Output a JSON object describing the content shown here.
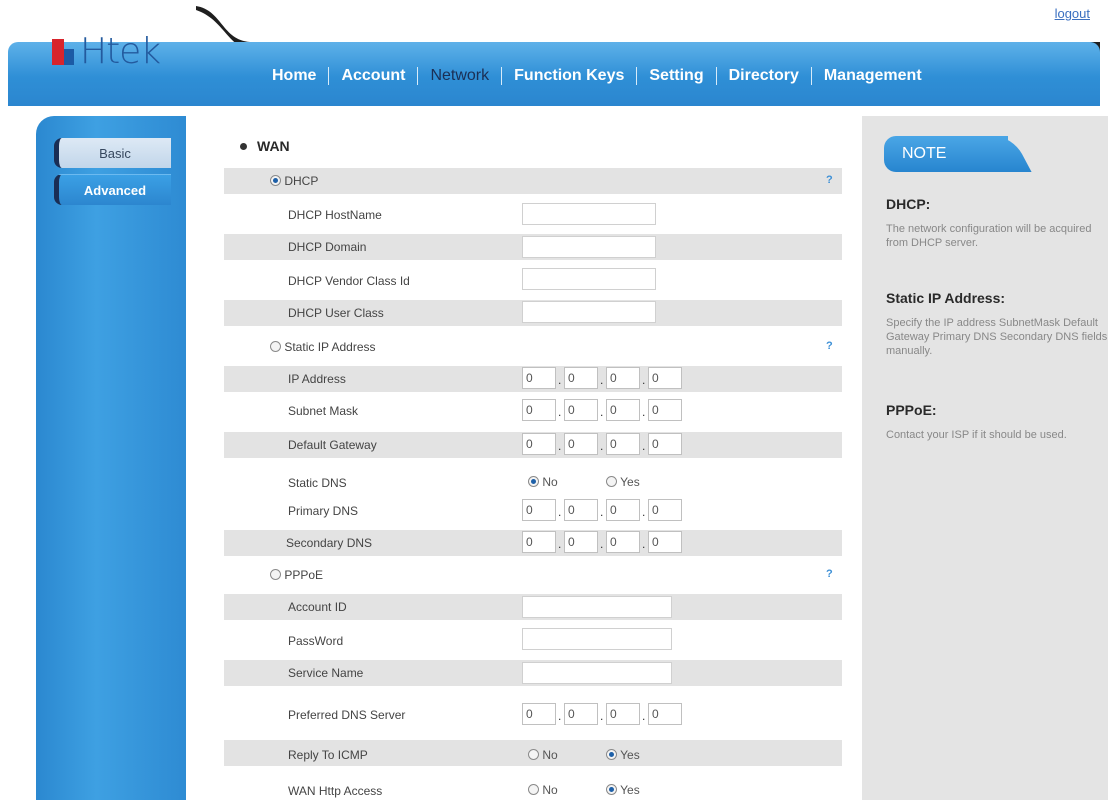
{
  "header": {
    "logo_text": "Htek",
    "logout": "logout",
    "nav": [
      "Home",
      "Account",
      "Network",
      "Function Keys",
      "Setting",
      "Directory",
      "Management"
    ],
    "active_nav": "Network"
  },
  "sidebar": {
    "tabs": [
      "Basic",
      "Advanced"
    ],
    "active": "Basic"
  },
  "form": {
    "section_title": "WAN",
    "help": "?",
    "dhcp": {
      "label": "DHCP",
      "selected": true,
      "fields": [
        "DHCP HostName",
        "DHCP Domain",
        "DHCP Vendor Class Id",
        "DHCP User Class"
      ]
    },
    "static": {
      "label": "Static IP Address",
      "ip_label": "IP Address",
      "ip": [
        "0",
        "0",
        "0",
        "0"
      ],
      "mask_label": "Subnet Mask",
      "mask": [
        "0",
        "0",
        "0",
        "0"
      ],
      "gw_label": "Default Gateway",
      "gw": [
        "0",
        "0",
        "0",
        "0"
      ],
      "static_dns_label": "Static DNS",
      "no": "No",
      "yes": "Yes",
      "pdns_label": "Primary DNS",
      "pdns": [
        "0",
        "0",
        "0",
        "0"
      ],
      "sdns_label": "Secondary DNS",
      "sdns": [
        "0",
        "0",
        "0",
        "0"
      ]
    },
    "pppoe": {
      "label": "PPPoE",
      "account_label": "Account ID",
      "password_label": "PassWord",
      "service_label": "Service Name"
    },
    "preferred_dns_label": "Preferred DNS Server",
    "preferred_dns": [
      "0",
      "0",
      "0",
      "0"
    ],
    "icmp_label": "Reply To ICMP",
    "http_label": "WAN Http Access"
  },
  "note": {
    "title": "NOTE",
    "dhcp_h": "DHCP:",
    "dhcp_t": "The network configuration will be acquired from DHCP server.",
    "static_h": "Static IP Address:",
    "static_t": "Specify the IP address SubnetMask Default Gateway Primary DNS Secondary DNS fields manually.",
    "pppoe_h": "PPPoE:",
    "pppoe_t": "Contact your ISP if it should be used."
  },
  "colors": {
    "brand_blue": "#2f8fd6",
    "logo_red": "#d8242c",
    "row_shade": "#e3e3e3",
    "note_bg": "#e4e4e4"
  }
}
